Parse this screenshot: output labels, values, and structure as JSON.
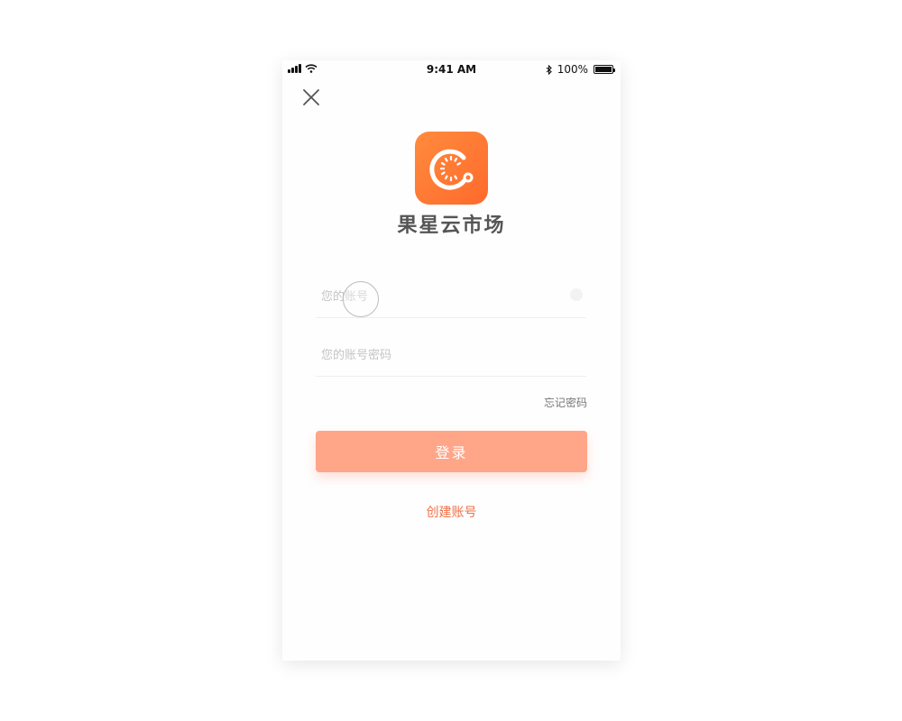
{
  "status_bar": {
    "time": "9:41 AM",
    "battery_text": "100%",
    "battery_level": 1.0,
    "icons": [
      "signal-icon",
      "wifi-icon",
      "bluetooth-icon",
      "battery-icon"
    ]
  },
  "header": {
    "close_icon": "close-icon"
  },
  "app": {
    "logo_icon": "app-logo-icon",
    "name": "果星云市场",
    "brand_color": "#ff6f2e"
  },
  "form": {
    "account_placeholder": "您的账号",
    "account_value": "",
    "password_placeholder": "您的账号密码",
    "password_value": "",
    "forgot_label": "忘记密码",
    "login_label": "登录",
    "create_label": "创建账号"
  },
  "colors": {
    "login_button": "#ffa688",
    "create_link": "#f07048",
    "text_muted": "#777777"
  }
}
